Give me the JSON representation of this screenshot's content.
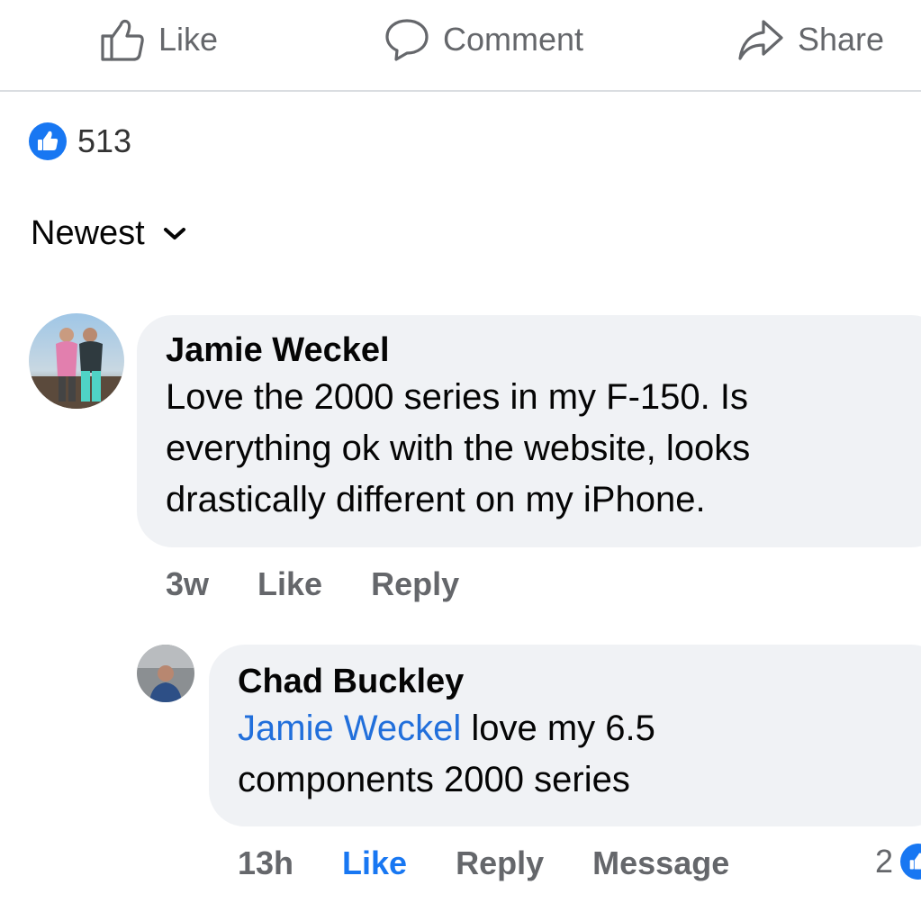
{
  "actions": {
    "like_label": "Like",
    "comment_label": "Comment",
    "share_label": "Share"
  },
  "reactions": {
    "count": "513",
    "icon": "thumbs-up-icon"
  },
  "sort": {
    "label": "Newest"
  },
  "comments": [
    {
      "author": "Jamie Weckel",
      "text_lines": [
        "Love the 2000 series in my F-150. Is",
        "everything ok with the website, looks",
        "drastically different on my iPhone."
      ],
      "time": "3w",
      "like_label": "Like",
      "reply_label": "Reply"
    }
  ],
  "reply": {
    "author": "Chad Buckley",
    "mention": "Jamie Weckel",
    "text_line1": " love my 6.5",
    "text_line2": "components 2000 series",
    "time": "13h",
    "like_label": "Like",
    "reply_label": "Reply",
    "message_label": "Message",
    "reaction_count": "2"
  },
  "colors": {
    "accent": "#1877f2",
    "mention": "#216fdb",
    "bubble": "#f0f2f5",
    "muted": "#65676b"
  }
}
